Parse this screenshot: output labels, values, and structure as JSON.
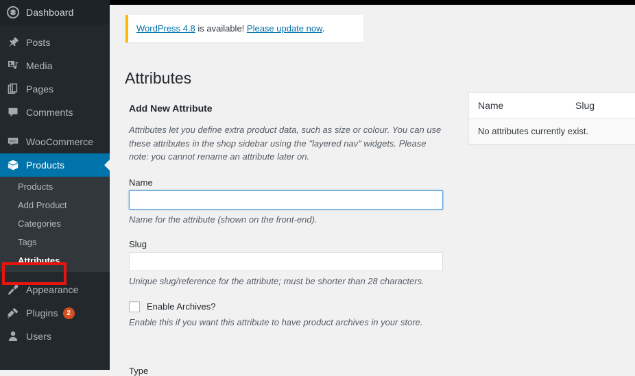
{
  "sidebar": {
    "items": [
      {
        "label": "Dashboard",
        "icon": "dashboard-icon",
        "name": "dashboard",
        "state": "dash"
      },
      {
        "label": "Posts",
        "icon": "pin-icon",
        "name": "posts",
        "state": ""
      },
      {
        "label": "Media",
        "icon": "media-icon",
        "name": "media",
        "state": ""
      },
      {
        "label": "Pages",
        "icon": "pages-icon",
        "name": "pages",
        "state": ""
      },
      {
        "label": "Comments",
        "icon": "comment-icon",
        "name": "comments",
        "state": ""
      },
      {
        "label": "WooCommerce",
        "icon": "woocommerce-icon",
        "name": "woocommerce",
        "state": ""
      },
      {
        "label": "Products",
        "icon": "products-icon",
        "name": "products",
        "state": "current"
      },
      {
        "label": "Appearance",
        "icon": "appearance-icon",
        "name": "appearance",
        "state": ""
      },
      {
        "label": "Plugins",
        "icon": "plugins-icon",
        "name": "plugins",
        "state": "",
        "badge": "2"
      },
      {
        "label": "Users",
        "icon": "users-icon",
        "name": "users",
        "state": ""
      }
    ],
    "submenu": [
      {
        "label": "Products",
        "name": "products",
        "current": false
      },
      {
        "label": "Add Product",
        "name": "add-product",
        "current": false
      },
      {
        "label": "Categories",
        "name": "categories",
        "current": false
      },
      {
        "label": "Tags",
        "name": "tags",
        "current": false
      },
      {
        "label": "Attributes",
        "name": "attributes",
        "current": true
      }
    ],
    "accent_color": "#0073aa",
    "background_color": "#23282d",
    "submenu_background_color": "#32373c",
    "badge_color": "#d54e21"
  },
  "annotation": {
    "color": "#e8150e",
    "target": "Attributes"
  },
  "notice": {
    "version_link": "WordPress 4.8",
    "middle_text": " is available! ",
    "update_link": "Please update now",
    "end_text": ".",
    "border_color": "#ffb900"
  },
  "page": {
    "title": "Attributes"
  },
  "form": {
    "heading": "Add New Attribute",
    "intro": "Attributes let you define extra product data, such as size or colour. You can use these attributes in the shop sidebar using the \"layered nav\" widgets. Please note: you cannot rename an attribute later on.",
    "name_label": "Name",
    "name_value": "",
    "name_placeholder": "",
    "name_desc": "Name for the attribute (shown on the front-end).",
    "slug_label": "Slug",
    "slug_value": "",
    "slug_placeholder": "",
    "slug_desc": "Unique slug/reference for the attribute; must be shorter than 28 characters.",
    "archives_label": "Enable Archives?",
    "archives_checked": false,
    "archives_desc": "Enable this if you want this attribute to have product archives in your store.",
    "type_label": "Type"
  },
  "table": {
    "columns": [
      "Name",
      "Slug"
    ],
    "empty_message": "No attributes currently exist.",
    "rows": []
  }
}
